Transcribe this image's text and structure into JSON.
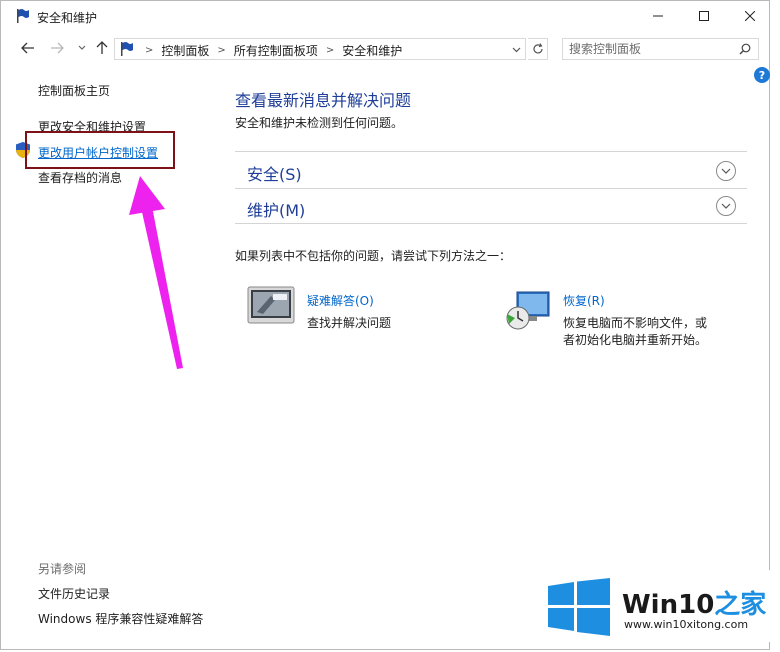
{
  "window": {
    "title": "安全和维护",
    "controls": {
      "minimize": "—",
      "maximize": "☐",
      "close": "✕"
    }
  },
  "nav": {
    "breadcrumb": [
      "控制面板",
      "所有控制面板项",
      "安全和维护"
    ],
    "search_placeholder": "搜索控制面板"
  },
  "sidebar": {
    "home": "控制面板主页",
    "items": [
      "更改安全和维护设置",
      "更改用户帐户控制设置",
      "查看存档的消息"
    ],
    "see_also_title": "另请参阅",
    "see_also": [
      "文件历史记录",
      "Windows 程序兼容性疑难解答"
    ]
  },
  "main": {
    "heading": "查看最新消息并解决问题",
    "status": "安全和维护未检测到任何问题。",
    "sections": [
      "安全(S)",
      "维护(M)"
    ],
    "suggest": "如果列表中不包括你的问题，请尝试下列方法之一：",
    "troubleshoot": {
      "title": "疑难解答(O)",
      "desc": "查找并解决问题"
    },
    "recovery": {
      "title": "恢复(R)",
      "desc1": "恢复电脑而不影响文件，或",
      "desc2": "者初始化电脑并重新开始。"
    }
  },
  "help_label": "?",
  "watermark": {
    "brand": "Win10",
    "brand_suffix": "之家",
    "url": "www.win10xitong.com"
  },
  "colors": {
    "link": "#0066cc",
    "heading": "#1e3e99",
    "highlight": "#7d1118",
    "arrow": "#ee22ee"
  }
}
